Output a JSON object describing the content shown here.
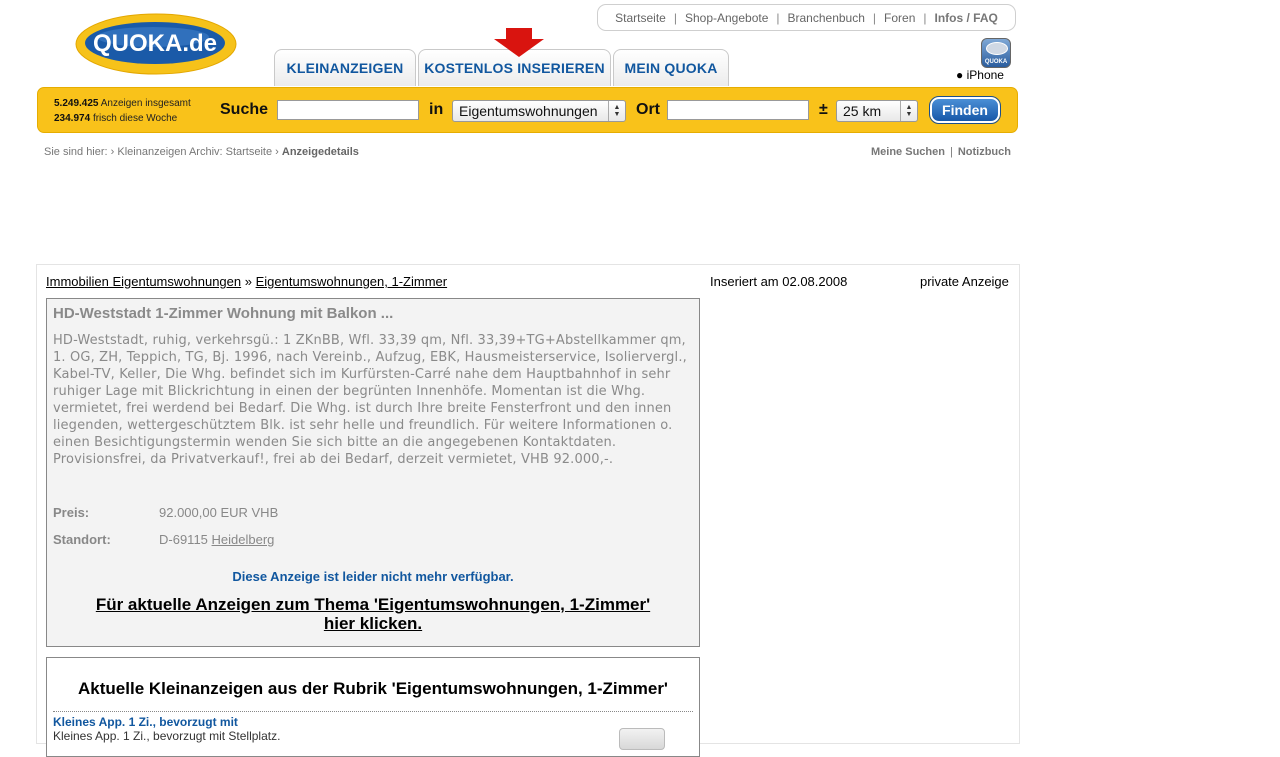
{
  "logo": {
    "text": "QUOKA.de"
  },
  "top_links": [
    {
      "label": "Startseite"
    },
    {
      "label": "Shop-Angebote"
    },
    {
      "label": "Branchenbuch"
    },
    {
      "label": "Foren"
    },
    {
      "label": "Infos / FAQ"
    }
  ],
  "tabs": [
    {
      "label": "KLEINANZEIGEN"
    },
    {
      "label": "KOSTENLOS INSERIEREN"
    },
    {
      "label": "MEIN QUOKA"
    }
  ],
  "iphone": {
    "icon_label": "QUOKA",
    "text": "iPhone"
  },
  "search": {
    "stats_total_count": "5.249.425",
    "stats_total_label": "Anzeigen insgesamt",
    "stats_week_count": "234.974",
    "stats_week_label": "frisch diese Woche",
    "suche_label": "Suche",
    "in_label": "in",
    "category_selected": "Eigentumswohnungen",
    "ort_label": "Ort",
    "radius_symbol": "±",
    "radius_selected": "25 km",
    "button_label": "Finden"
  },
  "breadcrumb": {
    "prefix": "Sie sind hier:",
    "sep": "›",
    "item1": "Kleinanzeigen Archiv: Startseite",
    "current": "Anzeigedetails"
  },
  "right_links": {
    "meine_suchen": "Meine Suchen",
    "notizbuch": "Notizbuch"
  },
  "category_path": {
    "link1": "Immobilien Eigentumswohnungen",
    "sep": "»",
    "link2": "Eigentumswohnungen, 1-Zimmer"
  },
  "ad_meta": {
    "inserted": "Inseriert am 02.08.2008",
    "type": "private Anzeige"
  },
  "ad": {
    "title": "HD-Weststadt 1-Zimmer Wohnung mit Balkon ...",
    "description": "HD-Weststadt, ruhig, verkehrsgü.: 1 ZKnBB, Wfl. 33,39 qm, Nfl. 33,39+TG+Abstellkammer qm, 1. OG, ZH, Teppich, TG, Bj. 1996, nach Vereinb., Aufzug, EBK, Hausmeisterservice, Isoliervergl., Kabel-TV, Keller, Die Whg. befindet sich im Kurfürsten-Carré nahe dem Hauptbahnhof in sehr ruhiger Lage mit Blickrichtung in einen der begrünten Innenhöfe. Momentan ist die Whg. vermietet, frei werdend bei Bedarf. Die Whg. ist durch Ihre breite Fensterfront und den innen liegenden, wettergeschütztem Blk. ist sehr helle und freundlich. Für weitere Informationen o. einen Besichtigungstermin wenden Sie sich bitte an die angegebenen Kontaktdaten. Provisionsfrei, da Privatverkauf!, frei ab dei Bedarf, derzeit vermietet, VHB 92.000,-.",
    "price_label": "Preis:",
    "price_value": "92.000,00 EUR VHB",
    "location_label": "Standort:",
    "location_zip": "D-69115",
    "location_city": "Heidelberg",
    "notice": "Diese Anzeige ist leider nicht mehr verfügbar.",
    "cta_line1": "Für aktuelle Anzeigen zum Thema 'Eigentumswohnungen, 1-Zimmer'",
    "cta_line2": "hier klicken."
  },
  "listing": {
    "title": "Aktuelle Kleinanzeigen aus der Rubrik 'Eigentumswohnungen, 1-Zimmer'",
    "items": [
      {
        "title": "Kleines App. 1 Zi., bevorzugt mit",
        "text": "Kleines App. 1 Zi., bevorzugt mit Stellplatz."
      }
    ]
  },
  "colors": {
    "accent_blue": "#11579f",
    "search_bar_yellow": "#f9c21a",
    "logo_blue": "#1a5aa8",
    "arrow_red": "#d9140f"
  }
}
